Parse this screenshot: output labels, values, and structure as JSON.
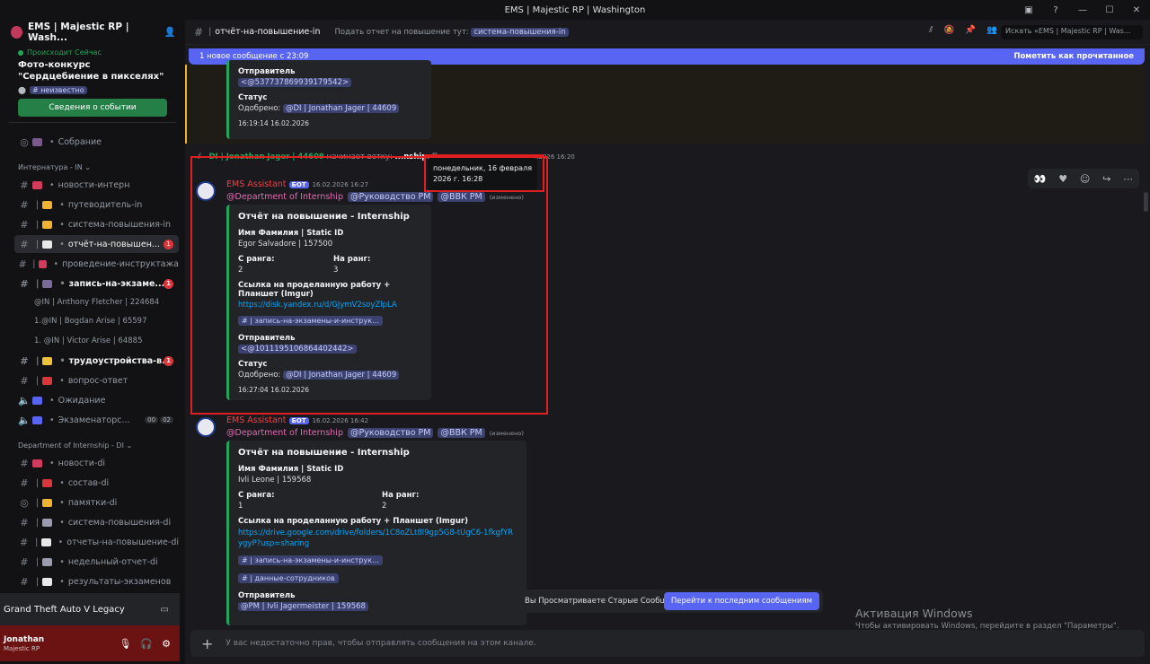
{
  "window": {
    "title": "EMS | Majestic RP | Washington"
  },
  "server": {
    "name": "EMS | Majestic RP | Wash..."
  },
  "event": {
    "status": "Происходит Сейчас",
    "title": "Фото-конкурс \"Сердцебиение в пикселях\"",
    "location": "# неизвестно",
    "button": "Сведения о событии"
  },
  "channels": {
    "voice1": "Собрание",
    "cat1": "Интернатура - IN",
    "c1": "новости-интерн",
    "c2": "путеводитель-in",
    "c3": "система-повышения-in",
    "c4": "отчёт-на-повышен...",
    "c4_badge": "1",
    "c5": "проведение-инструктажа",
    "c6": "запись-на-экзаме...",
    "c6_badge": "1",
    "t1": "@IN | Anthony Fletcher | 224684",
    "t2": "1.@IN | Bogdan Arise | 65597",
    "t3": "1. @IN | Victor Arise | 64885",
    "c7": "трудоустройства-в...",
    "c7_badge": "1",
    "c8": "вопрос-ответ",
    "voice2": "Ожидание",
    "voice3": "Экзаменаторс...",
    "voice3_a": "00",
    "voice3_b": "02",
    "cat2": "Department of Internship - DI",
    "d1": "новости-di",
    "d2": "состав-di",
    "d3": "памятки-di",
    "d4": "система-повышения-di",
    "d5": "отчеты-на-повышение-di",
    "d6": "недельный-отчет-di",
    "d7": "результаты-экзаменов"
  },
  "game": {
    "name": "Grand Theft Auto V Legacy"
  },
  "user": {
    "name": "Jonathan",
    "status": "Majestic RP"
  },
  "header": {
    "channel": "отчёт-на-повышение-in",
    "topic_prefix": "Подать отчет на повышение тут:",
    "topic_channel": "система-повышения-in",
    "search": "Искать «EMS | Majestic RP | Was..."
  },
  "newbar": {
    "text": "1 новое сообщение с 23:09",
    "mark": "Пометить как прочитанное"
  },
  "prev_embed": {
    "sender_label": "Отправитель",
    "sender": "<@537737869939179542>",
    "status_label": "Статус",
    "status": "Одобрено:",
    "status_mention": "@DI | Jonathan Jager | 44609",
    "footer": "16:19:14 16.02.2026"
  },
  "thread_notice": {
    "author": "DI | Jonathan Jager | 44609",
    "text1": "начинает ветку:",
    "thread": "...nship",
    "text2": ". Показать все",
    "link": "ветки",
    "time": "16.02.2026 16:20"
  },
  "tooltip": "понедельник, 16 февраля 2026 г. 16:28",
  "msg1": {
    "author": "EMS Assistant",
    "bot": "БОТ",
    "time": "16.02.2026 16:27",
    "role1": "@Department of Internship",
    "role2": "@Руководство PM",
    "role3": "@ВВК PM",
    "edited": "(изменено)",
    "title": "Отчёт на повышение - Internship",
    "f_name": "Имя Фамилия | Static ID",
    "v_name": "Egor Salvadore | 157500",
    "f_from": "С ранга:",
    "v_from": "2",
    "f_to": "На ранг:",
    "v_to": "3",
    "f_link": "Ссылка на проделанную работу + Планшет (Imgur)",
    "v_link": "https://disk.yandex.ru/d/GJymV2soyZlpLA",
    "pill": "# | запись-на-экзамены-и-инструк...",
    "f_sender": "Отправитель",
    "v_sender": "<@1011195106864402442>",
    "f_status": "Статус",
    "v_status": "Одобрено:",
    "v_status_m": "@DI | Jonathan Jager | 44609",
    "footer": "16:27:04 16.02.2026"
  },
  "msg2": {
    "author": "EMS Assistant",
    "bot": "БОТ",
    "time": "16.02.2026 16:42",
    "role1": "@Department of Internship",
    "role2": "@Руководство PM",
    "role3": "@ВВК PM",
    "edited": "(изменено)",
    "title": "Отчёт на повышение - Internship",
    "f_name": "Имя Фамилия | Static ID",
    "v_name": "Ivli Leone | 159568",
    "f_from": "С ранга:",
    "v_from": "1",
    "f_to": "На ранг:",
    "v_to": "2",
    "f_link": "Ссылка на проделанную работу + Планшет (Imgur)",
    "v_link": "https://drive.google.com/drive/folders/1C8oZLt8l9gp5G8-tUgC6-1fkgfYRygyP?usp=sharing",
    "pill1": "# | запись-на-экзамены-и-инструк...",
    "pill2": "# | данные-сотрудников",
    "f_sender": "Отправитель",
    "v_sender": "@PM | Ivli Jagermeister | 159568"
  },
  "old_msgs": {
    "text": "Вы Просматриваете Старые Сообщения",
    "button": "Перейти к последним сообщениям"
  },
  "composer": {
    "placeholder": "У вас недостаточно прав, чтобы отправлять сообщения на этом канале."
  },
  "watermark": {
    "line1": "Активация Windows",
    "line2": "Чтобы активировать Windows, перейдите в раздел \"Параметры\"."
  }
}
